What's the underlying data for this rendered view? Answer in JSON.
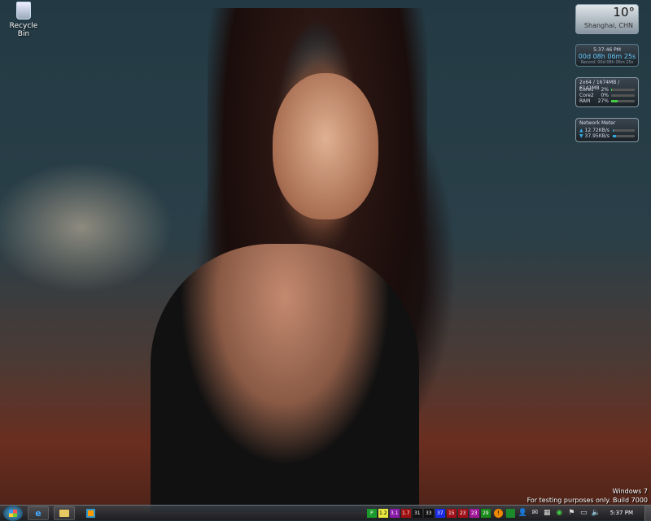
{
  "desktop": {
    "recycle_bin": "Recycle Bin"
  },
  "weather": {
    "temp": "10°",
    "city": "Shanghai, CHN"
  },
  "uptime": {
    "time": "5:37:46 PM",
    "uptime": "00d 08h 06m 25s",
    "record": "Record: 00d 08h 06m 25s"
  },
  "cpu": {
    "header": "2x64 / 1674MB / 6141MB",
    "rows": [
      {
        "label": "Core1",
        "value": "2%",
        "pct": 2
      },
      {
        "label": "Core2",
        "value": "0%",
        "pct": 0
      },
      {
        "label": "RAM",
        "value": "27%",
        "pct": 27
      }
    ]
  },
  "network": {
    "title": "Network Meter",
    "up": "12.72KB/s",
    "down": "37.95KB/s",
    "up_pct": 3,
    "down_pct": 15
  },
  "watermark": {
    "line1": "Windows  7",
    "line2": "For testing purposes only. Build 7000"
  },
  "taskbar": {
    "badges": [
      {
        "t": "P",
        "c": "#1a9a2a"
      },
      {
        "t": "1.2",
        "c": "#e8e840"
      },
      {
        "t": "3.1",
        "c": "#8a1aa8"
      },
      {
        "t": "1.7",
        "c": "#a01010"
      },
      {
        "t": "31",
        "c": "#111111"
      },
      {
        "t": "33",
        "c": "#111111"
      },
      {
        "t": "37",
        "c": "#1a2ae8"
      },
      {
        "t": "15",
        "c": "#a01018"
      },
      {
        "t": "23",
        "c": "#a01018"
      },
      {
        "t": "23",
        "c": "#a01898"
      },
      {
        "t": "29",
        "c": "#1a8a1a"
      }
    ],
    "clock": "5:37 PM"
  }
}
